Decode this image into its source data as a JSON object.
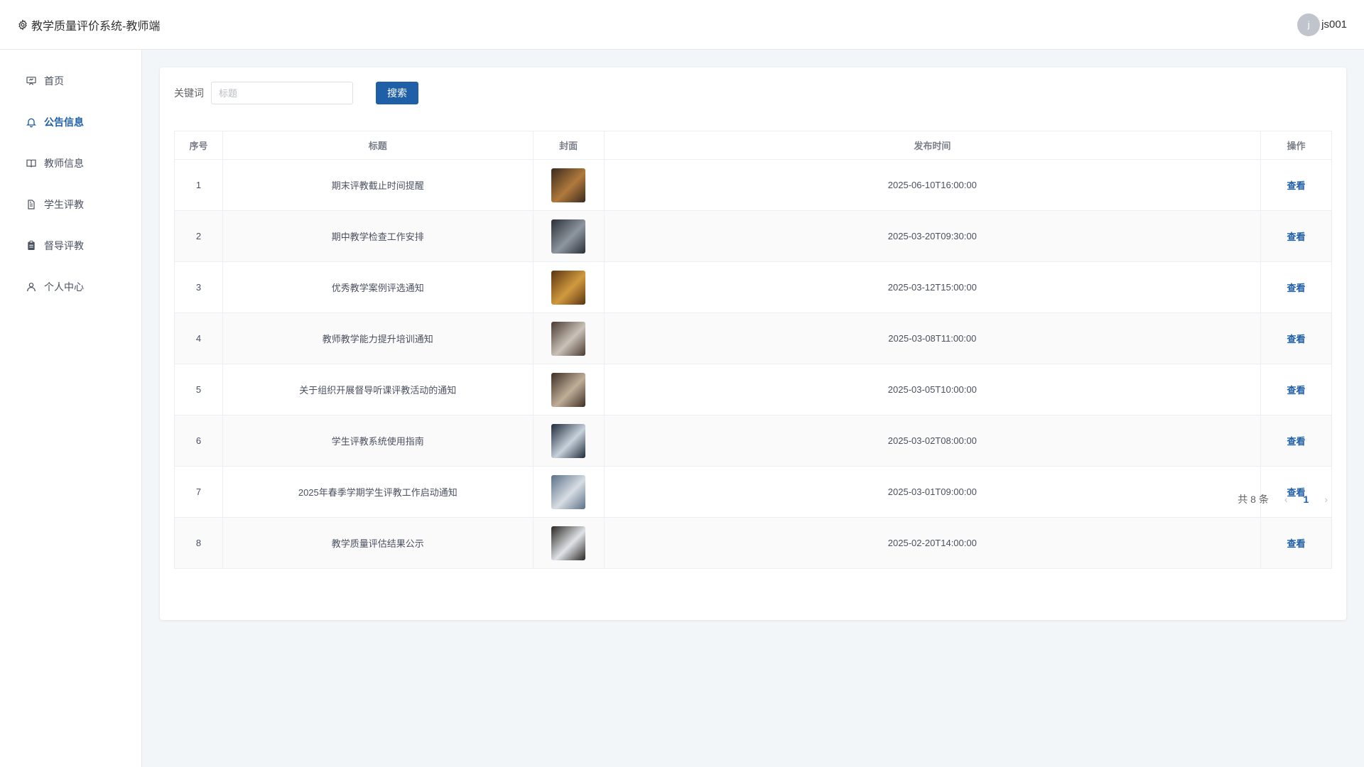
{
  "header": {
    "app_title": "教学质量评价系统-教师端",
    "username": "js001",
    "avatar_letter": "j"
  },
  "sidebar": {
    "items": [
      {
        "label": "首页",
        "icon": "presentation-icon"
      },
      {
        "label": "公告信息",
        "icon": "bell-icon",
        "active": true
      },
      {
        "label": "教师信息",
        "icon": "book-icon"
      },
      {
        "label": "学生评教",
        "icon": "document-icon"
      },
      {
        "label": "督导评教",
        "icon": "clipboard-icon"
      },
      {
        "label": "个人中心",
        "icon": "user-icon"
      }
    ]
  },
  "search": {
    "label": "关键词",
    "placeholder": "标题",
    "value": "",
    "button_label": "搜索"
  },
  "table": {
    "headers": [
      "序号",
      "标题",
      "封面",
      "发布时间",
      "操作"
    ],
    "rows": [
      {
        "index": "1",
        "title": "期末评教截止时间提醒",
        "time": "2025-06-10T16:00:00",
        "action": "查看",
        "cover_colors": [
          "#3a2a1e",
          "#b07a3c"
        ]
      },
      {
        "index": "2",
        "title": "期中教学检查工作安排",
        "time": "2025-03-20T09:30:00",
        "action": "查看",
        "cover_colors": [
          "#2b2f36",
          "#8d96a0"
        ]
      },
      {
        "index": "3",
        "title": "优秀教学案例评选通知",
        "time": "2025-03-12T15:00:00",
        "action": "查看",
        "cover_colors": [
          "#5a3412",
          "#d19a3e"
        ]
      },
      {
        "index": "4",
        "title": "教师教学能力提升培训通知",
        "time": "2025-03-08T11:00:00",
        "action": "查看",
        "cover_colors": [
          "#4a3a30",
          "#c9c2b8"
        ]
      },
      {
        "index": "5",
        "title": "关于组织开展督导听课评教活动的通知",
        "time": "2025-03-05T10:00:00",
        "action": "查看",
        "cover_colors": [
          "#3d2e24",
          "#bfae98"
        ]
      },
      {
        "index": "6",
        "title": "学生评教系统使用指南",
        "time": "2025-03-02T08:00:00",
        "action": "查看",
        "cover_colors": [
          "#1e2a3a",
          "#c8d2dc"
        ]
      },
      {
        "index": "7",
        "title": "2025年春季学期学生评教工作启动通知",
        "time": "2025-03-01T09:00:00",
        "action": "查看",
        "cover_colors": [
          "#5b7088",
          "#d7dde3"
        ]
      },
      {
        "index": "8",
        "title": "教学质量评估结果公示",
        "time": "2025-02-20T14:00:00",
        "action": "查看",
        "cover_colors": [
          "#2a2622",
          "#dfe3e8"
        ]
      }
    ]
  },
  "pagination": {
    "total_label": "共 8 条",
    "current_page": "1",
    "prev_icon": "chevron-left-icon",
    "next_icon": "chevron-right-icon"
  },
  "colors": {
    "accent": "#1f5fa8",
    "background": "#f3f6f9"
  }
}
